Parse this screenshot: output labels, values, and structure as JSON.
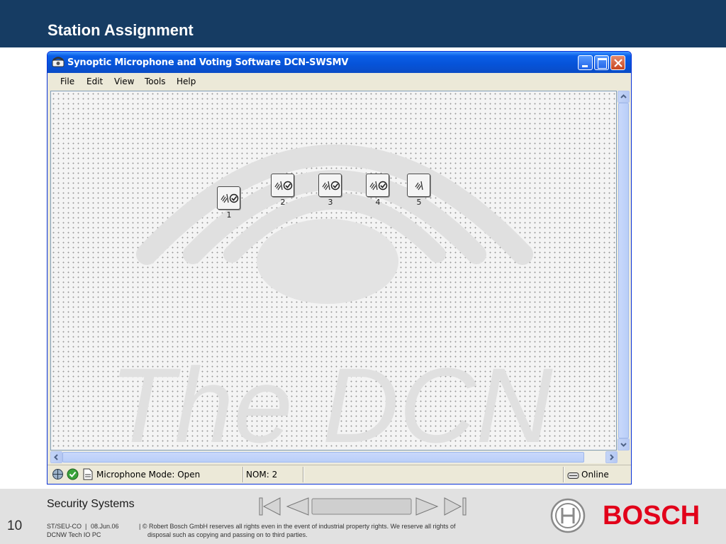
{
  "slide": {
    "title": "Station Assignment",
    "slide_number": "10",
    "company": "Security Systems",
    "footer_code": "ST/SEU-CO",
    "footer_date": "08.Jun.06",
    "footer_dept": "DCNW Tech IO PC",
    "footer_copyright_line1": "| © Robert Bosch GmbH reserves all rights even in the event of industrial property rights. We reserve all rights of",
    "footer_copyright_line2": "disposal such as copying and passing on to third parties.",
    "brand": "BOSCH",
    "brand_color": "#e2001a",
    "header_color": "#163c63"
  },
  "window": {
    "title": "Synoptic Microphone and Voting Software DCN-SWSMV",
    "menu": [
      "File",
      "Edit",
      "View",
      "Tools",
      "Help"
    ],
    "watermark_text": "The DCN",
    "seats": [
      {
        "label": "1",
        "icons": [
          "microphone-icon",
          "check-circle-icon"
        ]
      },
      {
        "label": "2",
        "icons": [
          "microphone-icon",
          "check-circle-icon"
        ]
      },
      {
        "label": "3",
        "icons": [
          "microphone-icon",
          "check-circle-icon"
        ]
      },
      {
        "label": "4",
        "icons": [
          "microphone-icon",
          "check-circle-icon"
        ]
      },
      {
        "label": "5",
        "icons": [
          "microphone-icon"
        ]
      }
    ],
    "status": {
      "mode": "Microphone Mode: Open",
      "nom": "NOM: 2",
      "connection": "Online"
    }
  }
}
